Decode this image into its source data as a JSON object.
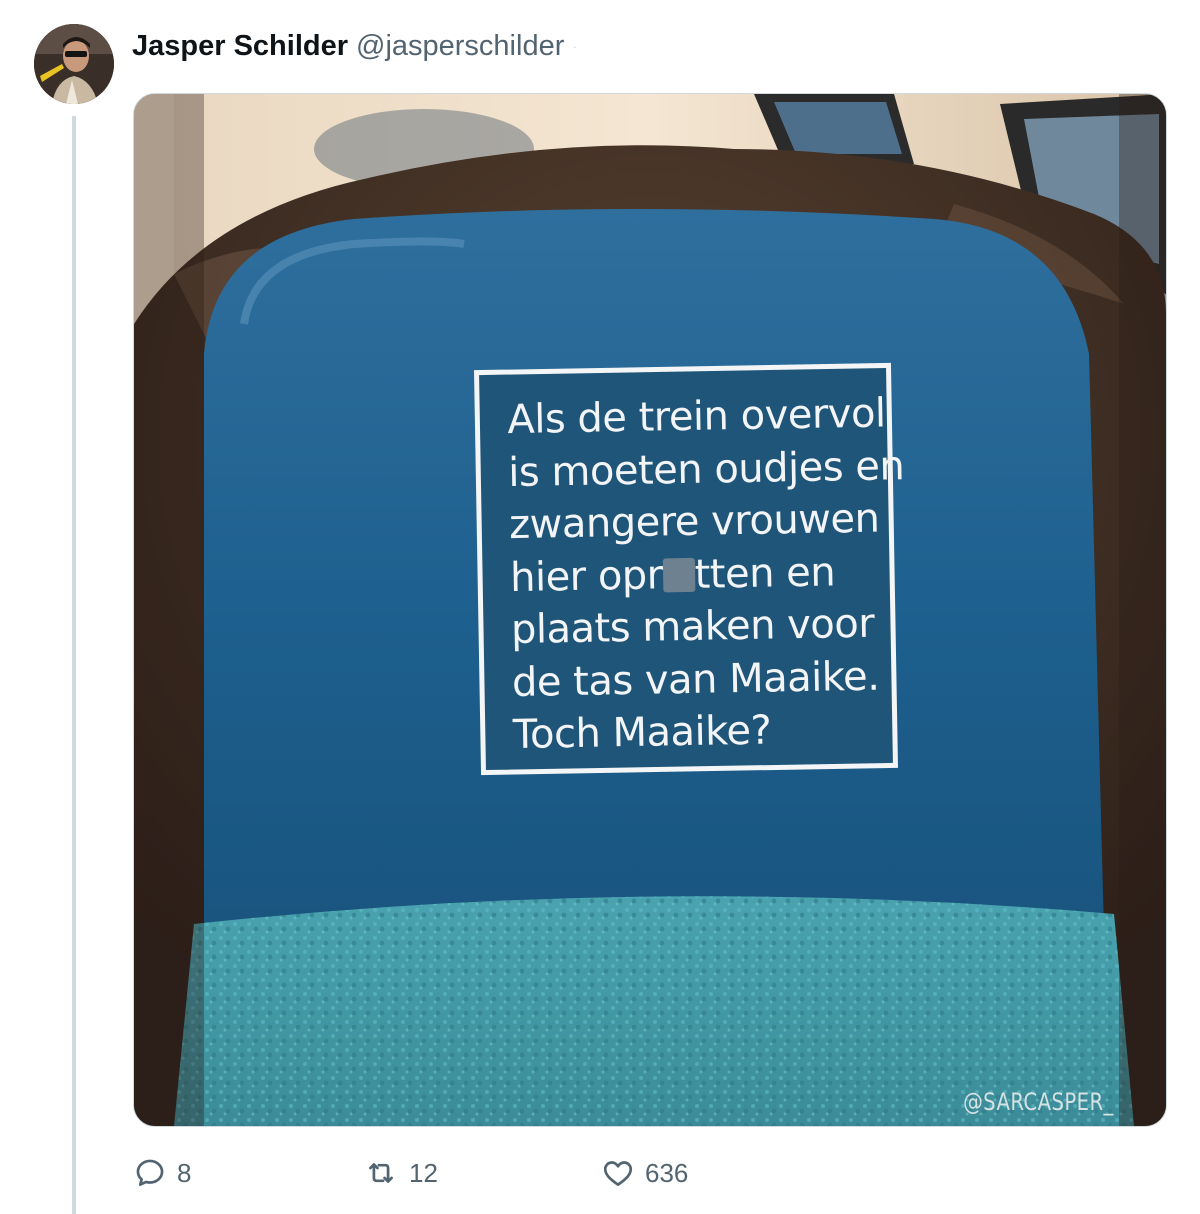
{
  "tweet": {
    "author": {
      "display_name": "Jasper Schilder",
      "handle": "@jasperschilder",
      "separator": "·"
    },
    "image": {
      "sign_text_line1": "Als de trein overvol",
      "sign_text_line2": "is moeten oudjes en",
      "sign_text_line3": "zwangere vrouwen",
      "sign_text_line4_before": "hier opr",
      "sign_text_line4_after": "tten en",
      "sign_text_line5": "plaats maken voor",
      "sign_text_line6": "de tas van Maaike.",
      "sign_text_line7": "Toch Maaike?",
      "watermark": "@SARCASPER_"
    },
    "actions": {
      "replies": "8",
      "retweets": "12",
      "likes": "636"
    }
  },
  "icons": {
    "reply": "reply-icon",
    "retweet": "retweet-icon",
    "like": "heart-icon"
  },
  "colors": {
    "text_primary": "#0f1419",
    "text_secondary": "#536471",
    "thread_line": "#cfd9de"
  }
}
